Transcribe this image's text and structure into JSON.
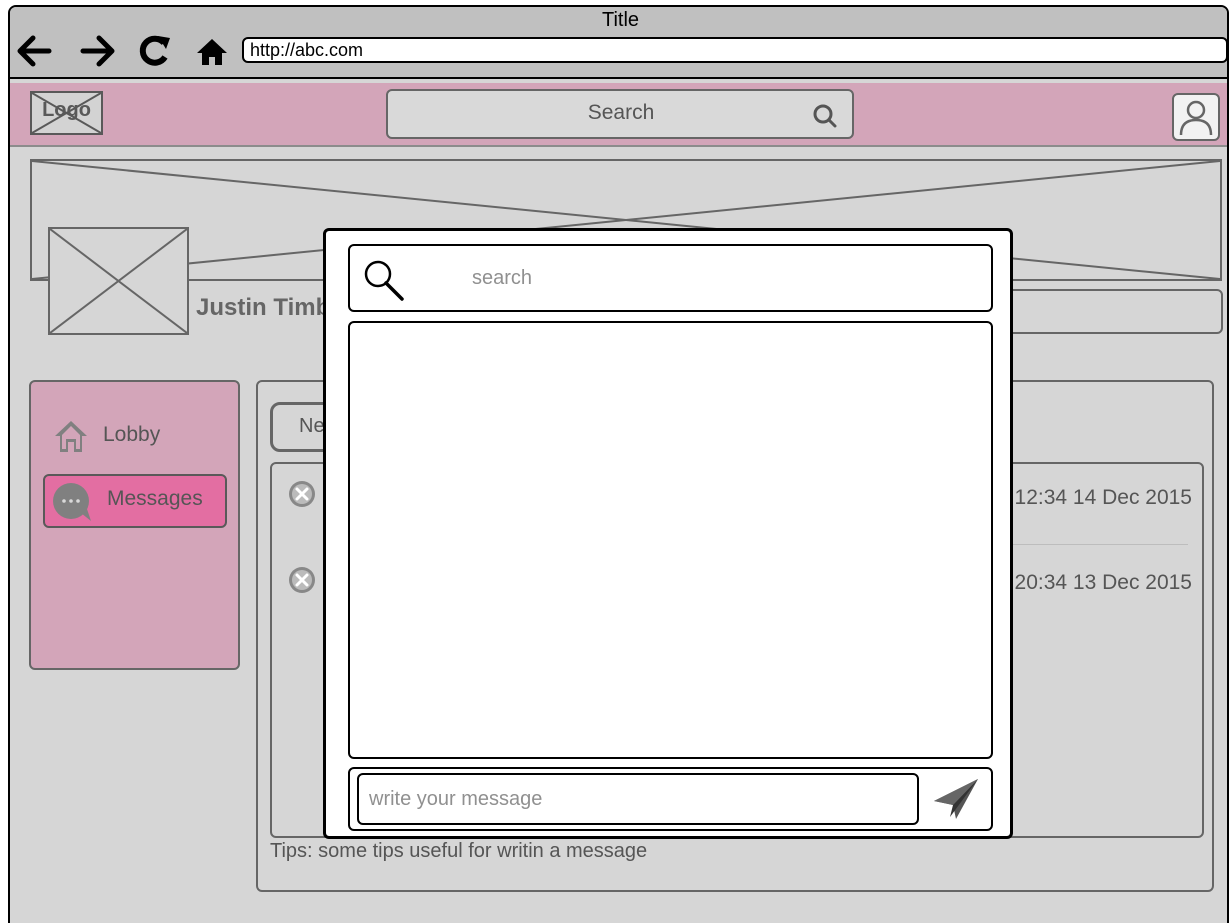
{
  "window": {
    "title": "Title"
  },
  "browser": {
    "url": "http://abc.com"
  },
  "header": {
    "logo_text": "Logo",
    "search_label": "Search"
  },
  "profile": {
    "user_name": "Justin Timberlake"
  },
  "sidebar": {
    "items": [
      {
        "label": "Lobby",
        "icon": "home-icon",
        "active": false
      },
      {
        "label": "Messages",
        "icon": "chat-bubble-icon",
        "active": true
      }
    ]
  },
  "content": {
    "new_button_label": "Ne",
    "messages": [
      {
        "time": "12:34 14 Dec 2015"
      },
      {
        "time": "20:34 13 Dec 2015"
      }
    ],
    "tips": "Tips: some tips useful for writin a message"
  },
  "modal": {
    "search_placeholder": "search",
    "compose_placeholder": "write your message"
  },
  "colors": {
    "header_bg": "#d3a5b9",
    "active_nav": "#e36ea2",
    "chrome_bg": "#c0c0c0",
    "page_bg": "#d6d6d6"
  }
}
